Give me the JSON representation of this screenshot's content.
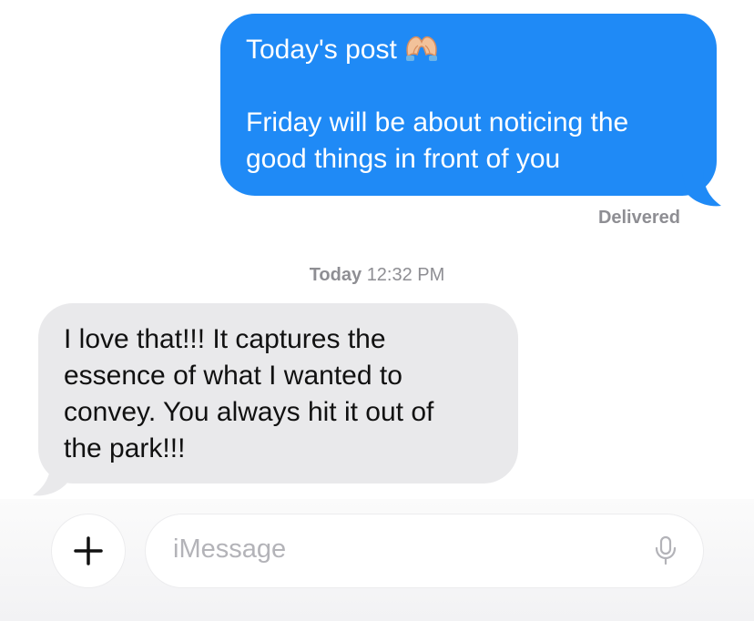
{
  "conversation": {
    "outgoing": {
      "title_line": "Today's post",
      "title_emoji": "heart-hands-icon",
      "body_lines": [
        "Friday will be about noticing the",
        "good things in front of you"
      ],
      "bubble_color": "#1f8af6",
      "status": "Delivered"
    },
    "timestamp": {
      "day": "Today",
      "time": "12:32 PM"
    },
    "incoming": {
      "lines": [
        "I love that!!! It captures the",
        "essence of what I wanted to",
        "convey. You always hit it out of",
        "the park!!!"
      ],
      "bubble_color": "#e9e9eb"
    }
  },
  "composer": {
    "plus_icon": "plus-icon",
    "placeholder": "iMessage",
    "mic_icon": "microphone-icon"
  }
}
